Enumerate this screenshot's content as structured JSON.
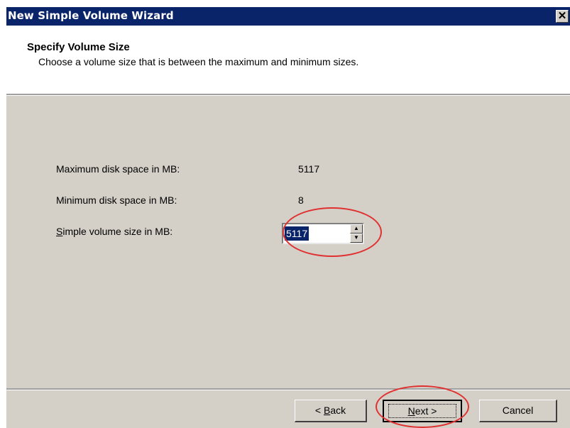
{
  "window": {
    "title": "New Simple Volume Wizard",
    "close_label": "✕"
  },
  "header": {
    "title": "Specify Volume Size",
    "subtitle": "Choose a volume size that is between the maximum and minimum sizes."
  },
  "form": {
    "max_label": "Maximum disk space in MB:",
    "max_value": "5117",
    "min_label": "Minimum disk space in MB:",
    "min_value": "8",
    "size_label_prefix": "S",
    "size_label_rest": "imple volume size in MB:",
    "size_value": "5117"
  },
  "buttons": {
    "back_prefix": "< ",
    "back_key": "B",
    "back_rest": "ack",
    "next_key": "N",
    "next_rest": "ext >",
    "cancel": "Cancel"
  },
  "colors": {
    "title_bar": "#0a246a",
    "dialog_bg": "#d4d0c8",
    "highlight_annotation": "#e03030"
  },
  "icons": {
    "close": "close-icon",
    "spin_up": "chevron-up-icon",
    "spin_down": "chevron-down-icon"
  }
}
